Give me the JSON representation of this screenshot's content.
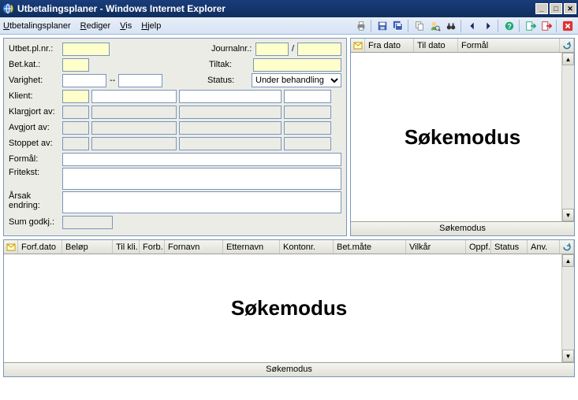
{
  "window": {
    "title": "Utbetalingsplaner - Windows Internet Explorer"
  },
  "menu": {
    "utbetalingsplaner": "Utbetalingsplaner",
    "rediger": "Rediger",
    "vis": "Vis",
    "hjelp": "Hjelp"
  },
  "form": {
    "utbet_label": "Utbet.pl.nr.:",
    "journal_label": "Journalnr.:",
    "betkat_label": "Bet.kat.:",
    "tiltak_label": "Tiltak:",
    "varighet_label": "Varighet:",
    "status_label": "Status:",
    "status_value": "Under behandling",
    "klient_label": "Klient:",
    "klargjort_label": "Klargjort av:",
    "avgjort_label": "Avgjort av:",
    "stoppet_label": "Stoppet av:",
    "formal_label": "Formål:",
    "fritekst_label": "Fritekst:",
    "arsak_label1": "Årsak",
    "arsak_label2": "endring:",
    "sumgodkj_label": "Sum godkj.:"
  },
  "grid_upper": {
    "col_fradato": "Fra dato",
    "col_tildato": "Til dato",
    "col_formal": "Formål",
    "body_text": "Søkemodus",
    "footer": "Søkemodus"
  },
  "grid_lower": {
    "col_forfdato": "Forf.dato",
    "col_belop": "Beløp",
    "col_tilkli": "Til kli.",
    "col_forb": "Forb.",
    "col_fornavn": "Fornavn",
    "col_etternavn": "Etternavn",
    "col_kontonr": "Kontonr.",
    "col_betmate": "Bet.måte",
    "col_vilkar": "Vilkår",
    "col_oppf": "Oppf.",
    "col_status": "Status",
    "col_anv": "Anv.",
    "body_text": "Søkemodus",
    "footer": "Søkemodus"
  }
}
